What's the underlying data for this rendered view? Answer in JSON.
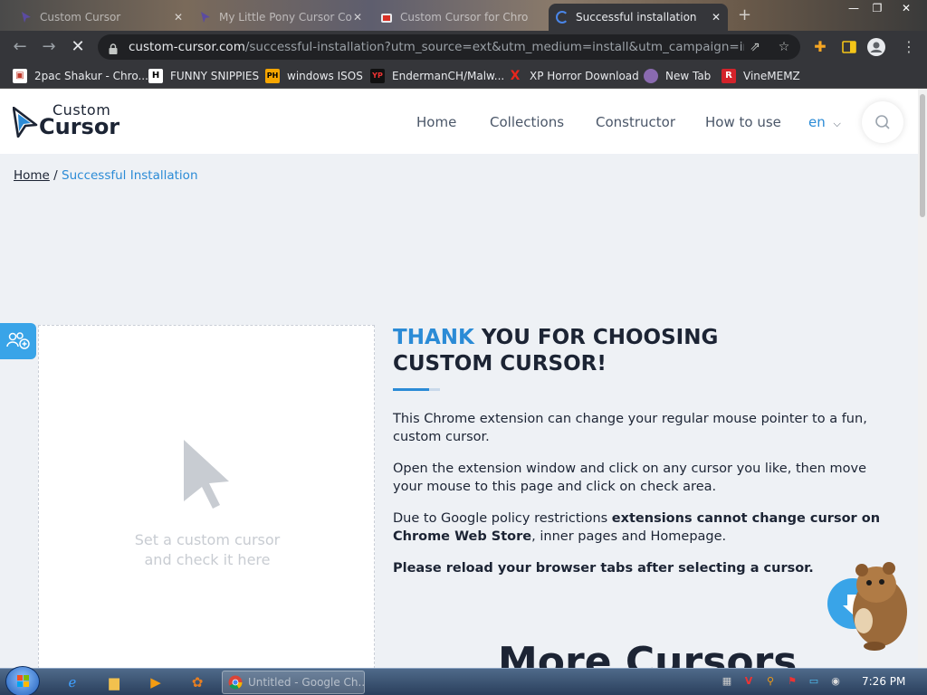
{
  "tabs": [
    {
      "title": "Custom Cursor"
    },
    {
      "title": "My Little Pony Cursor Co"
    },
    {
      "title": "Custom Cursor for Chro"
    },
    {
      "title": "Successful installation"
    }
  ],
  "address_bar": {
    "host": "custom-cursor.com",
    "path": "/successful-installation?utm_source=ext&utm_medium=install&utm_campaign=install_s..."
  },
  "bookmarks": [
    {
      "label": "2pac Shakur - Chro...",
      "icon": "bag-icon"
    },
    {
      "label": "FUNNY SNIPPIES",
      "icon": "H"
    },
    {
      "label": "windows ISOS",
      "icon": "PH"
    },
    {
      "label": "EndermanCH/Malw...",
      "icon": "YP"
    },
    {
      "label": "XP Horror Download",
      "icon": "X"
    },
    {
      "label": "New Tab",
      "icon": "globe-icon"
    },
    {
      "label": "VineMEMZ",
      "icon": "R"
    }
  ],
  "site": {
    "logo_top": "Custom",
    "logo_bottom": "Cursor",
    "nav": [
      "Home",
      "Collections",
      "Constructor",
      "How to use"
    ],
    "lang": "en"
  },
  "breadcrumb": {
    "home": "Home",
    "separator": "/",
    "current": "Successful Installation"
  },
  "check_area": {
    "line1": "Set a custom cursor",
    "line2": "and check it here"
  },
  "content": {
    "heading_accent": "THANK",
    "heading_rest": " YOU FOR CHOOSING",
    "heading_line2": "CUSTOM CURSOR!",
    "p1": "This Chrome extension can change your regular mouse pointer to a fun, custom cursor.",
    "p2": "Open the extension window and click on any cursor you like, then move your mouse to this page and click on check area.",
    "p3_a": "Due to Google policy restrictions ",
    "p3_b": "extensions cannot change cursor on Chrome Web Store",
    "p3_c": ", inner pages and Homepage.",
    "p4": "Please reload your browser tabs after selecting a cursor.",
    "more_title": "More Cursors"
  },
  "taskbar": {
    "task_label": "Untitled - Google Ch...",
    "clock": "7:26 PM"
  },
  "colors": {
    "accent": "#2b8bd6",
    "navy": "#1c2434",
    "page_bg": "#eef1f5"
  }
}
